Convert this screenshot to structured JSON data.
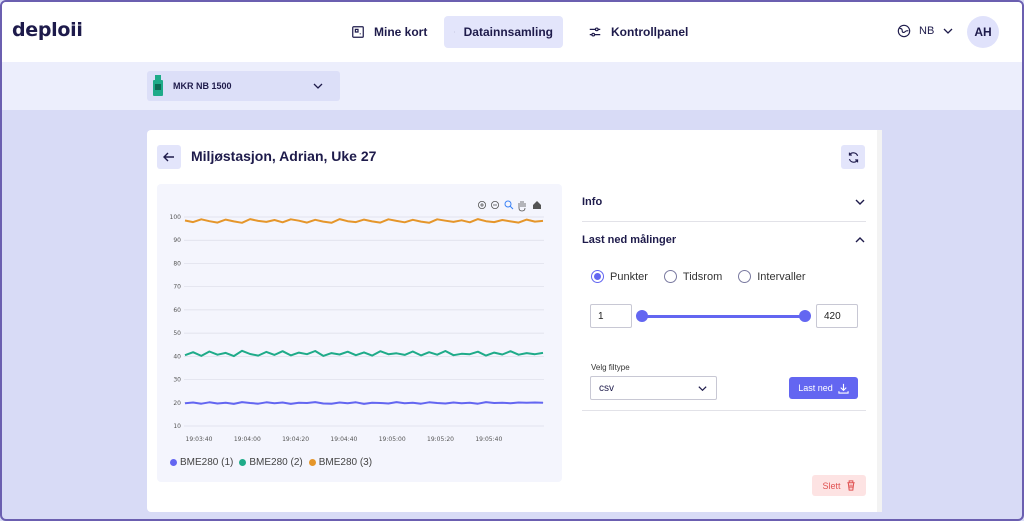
{
  "app": {
    "logo": "deploii"
  },
  "nav": {
    "items": [
      {
        "label": "Mine kort",
        "icon": "cards-icon"
      },
      {
        "label": "Datainnsamling",
        "icon": "save-icon",
        "active": true
      },
      {
        "label": "Kontrollpanel",
        "icon": "sliders-icon"
      }
    ],
    "language": "NB",
    "user_initials": "AH"
  },
  "device": {
    "selected": "MKR NB 1500"
  },
  "card": {
    "title": "Miljøstasjon, Adrian, Uke 27"
  },
  "sections": {
    "info": {
      "label": "Info",
      "expanded": false
    },
    "download": {
      "label": "Last ned målinger",
      "expanded": true,
      "modes": [
        "Punkter",
        "Tidsrom",
        "Intervaller"
      ],
      "selected_mode": "Punkter",
      "range_from": "1",
      "range_to": "420",
      "filetype_label": "Velg filtype",
      "filetype_value": "csv",
      "download_label": "Last ned"
    }
  },
  "delete_label": "Slett",
  "colors": {
    "accent": "#6366f1",
    "series1": "#6366f1",
    "series2": "#1fab89",
    "series3": "#e5962b"
  },
  "chart_data": {
    "type": "line",
    "x_ticks": [
      "19:03:40",
      "19:04:00",
      "19:04:20",
      "19:04:40",
      "19:05:00",
      "19:05:20",
      "19:05:40"
    ],
    "ylim": [
      10,
      100
    ],
    "y_ticks": [
      10,
      20,
      30,
      40,
      50,
      60,
      70,
      80,
      90,
      100
    ],
    "grid": true,
    "legend_position": "bottom",
    "series": [
      {
        "name": "BME280 (1)",
        "color": "#6366f1",
        "values": [
          19.8,
          20.1,
          19.6,
          20.2,
          19.7,
          20.0,
          19.5,
          20.3,
          19.9,
          19.6,
          20.2,
          19.8,
          20.1,
          19.5,
          20.0,
          19.9,
          20.3,
          19.7,
          19.6,
          20.1,
          19.8,
          20.2,
          19.5,
          20.0,
          19.9,
          19.7,
          20.3,
          19.8,
          20.0,
          19.6,
          20.2,
          19.9,
          19.7,
          20.1,
          19.8,
          20.0,
          19.6,
          20.3,
          19.9,
          20.0,
          19.8,
          20.1,
          20.0,
          20.1,
          20.0
        ]
      },
      {
        "name": "BME280 (2)",
        "color": "#1fab89",
        "values": [
          40.5,
          41.8,
          40.2,
          42.1,
          40.7,
          41.5,
          40.1,
          42.4,
          41.0,
          40.3,
          41.9,
          40.6,
          42.2,
          40.4,
          41.6,
          40.9,
          42.3,
          40.2,
          41.4,
          40.8,
          42.0,
          40.5,
          41.7,
          40.3,
          42.2,
          40.9,
          41.3,
          40.6,
          42.1,
          40.4,
          41.8,
          40.7,
          42.3,
          40.5,
          41.1,
          40.9,
          42.0,
          40.3,
          41.6,
          40.8,
          42.2,
          40.7,
          41.4,
          40.9,
          41.5
        ]
      },
      {
        "name": "BME280 (3)",
        "color": "#e5962b",
        "values": [
          98.5,
          97.8,
          99.0,
          98.2,
          97.6,
          98.9,
          98.1,
          97.5,
          99.1,
          98.3,
          97.9,
          98.7,
          97.7,
          99.0,
          98.4,
          97.6,
          98.8,
          98.0,
          97.5,
          99.1,
          98.2,
          97.8,
          98.9,
          98.1,
          97.6,
          99.0,
          98.3,
          97.7,
          98.8,
          98.0,
          97.5,
          99.0,
          98.4,
          97.9,
          98.6,
          97.7,
          99.1,
          98.2,
          97.8,
          98.7,
          98.1,
          97.6,
          98.9,
          98.0,
          98.3
        ]
      }
    ]
  }
}
